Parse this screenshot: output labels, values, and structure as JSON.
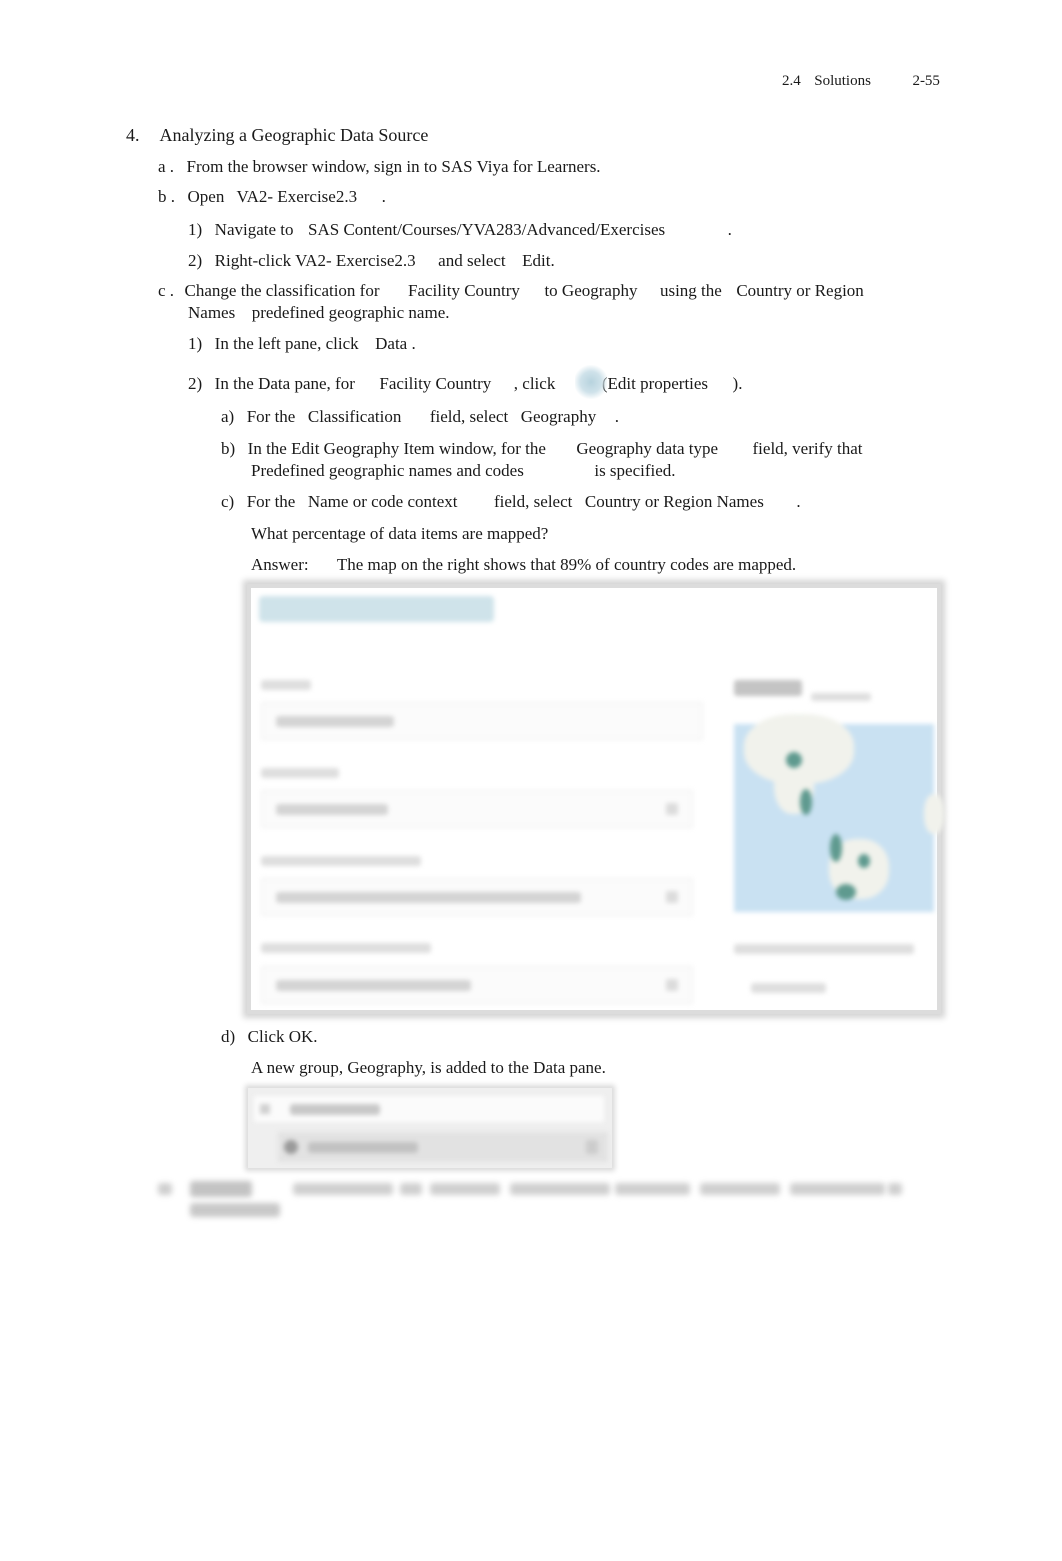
{
  "header": {
    "section": "2.4",
    "section_title": "Solutions",
    "page_number": "2-55"
  },
  "exercise": {
    "number": "4.",
    "title": "Analyzing a Geographic Data Source",
    "steps": {
      "a": {
        "marker": "a .",
        "text": "From the browser window, sign in to SAS Viya for Learners."
      },
      "b": {
        "marker": "b .",
        "text_pre": "Open",
        "report": "VA2- Exercise2.3",
        "text_post": ".",
        "substeps": {
          "1": {
            "marker": "1)",
            "text_pre": "Navigate  to",
            "path": "SAS Content/Courses/YVA283/Advanced/Exercises",
            "text_post": "."
          },
          "2": {
            "marker": "2)",
            "text_pre": "Right-click",
            "report": "VA2- Exercise2.3",
            "text_mid": "and select",
            "action": "Edit."
          }
        }
      },
      "c": {
        "marker": "c .",
        "line1_pre": "Change the classification for",
        "item": "Facility Country",
        "line1_mid": "to Geography",
        "line1_mid2": "using the",
        "option": "Country or Region",
        "line2_option": "Names",
        "line2_post": "predefined  geographic  name.",
        "substeps": {
          "1": {
            "marker": "1)",
            "text_pre": "In the left pane, click",
            "target": "Data",
            "text_post": "."
          },
          "2": {
            "marker": "2)",
            "text_pre": "In the Data pane, for",
            "item": "Facility Country",
            "text_mid": ", click",
            "icon": "edit-properties-icon",
            "text_paren": "(Edit properties",
            "text_post": ").",
            "substeps": {
              "a": {
                "marker": "a)",
                "text_pre": "For the",
                "field": "Classification",
                "text_mid": "field, select",
                "value": "Geography",
                "text_post": "."
              },
              "b": {
                "marker": "b)",
                "text_pre": "In the Edit Geography Item window, for the",
                "field": "Geography data type",
                "text_mid": "field, verify that",
                "value": "Predefined geographic names and codes",
                "text_post": "is specified."
              },
              "c": {
                "marker": "c)",
                "text_pre": "For the",
                "field": "Name or code context",
                "text_mid": "field, select",
                "value": "Country or Region Names",
                "text_post": ".",
                "question": "What percentage of data items are mapped?",
                "answer_label": "Answer:",
                "answer_text": "The map on the right shows that 89% of country codes are mapped."
              },
              "d": {
                "marker": "d)",
                "text": "Click OK.",
                "note": "A new group, Geography, is added to the Data pane."
              }
            }
          }
        }
      }
    }
  },
  "screenshots": {
    "edit_geography_dialog": {
      "content": "blurred",
      "map_colors": {
        "water": "#c9e1f2",
        "land": "#f1f2ec",
        "points": "#5f9a8f"
      }
    },
    "data_pane": {
      "content": "blurred"
    }
  },
  "colors": {
    "text": "#1a1a1a",
    "accent_icon": "#b7d3de"
  }
}
